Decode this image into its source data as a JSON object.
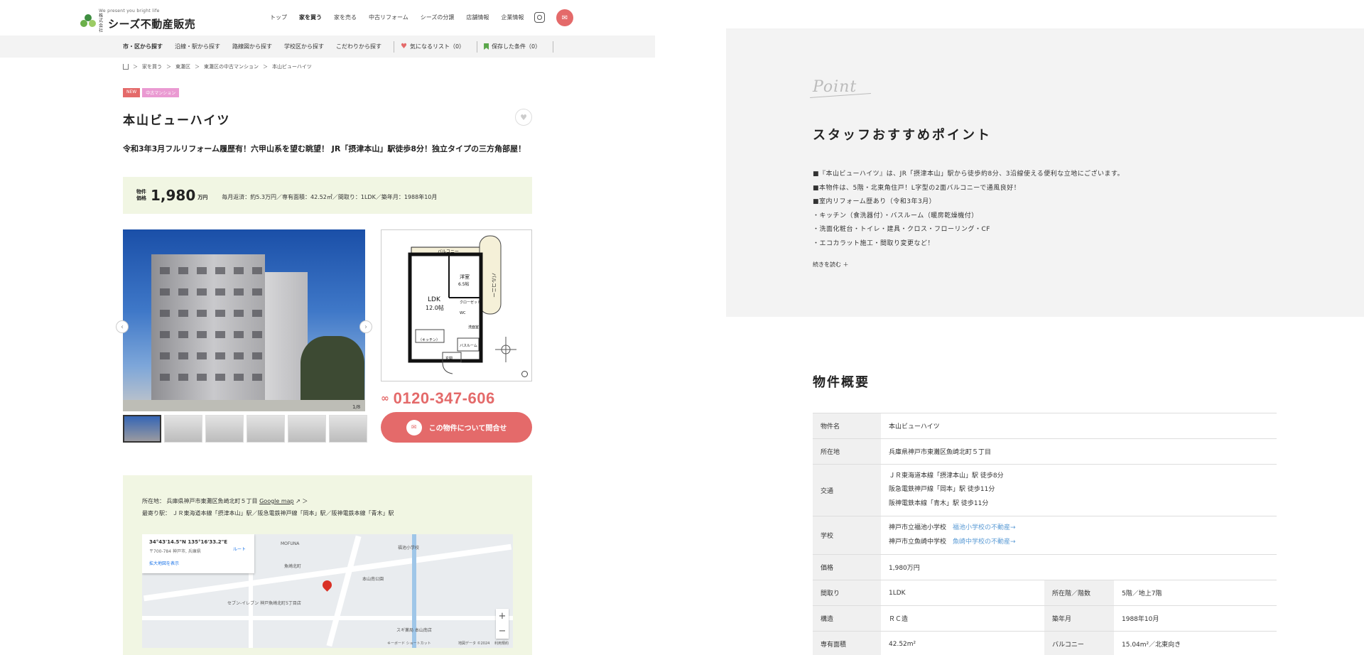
{
  "header": {
    "logo_tagline": "We present you bright life",
    "logo_corp": "株式会社",
    "logo_name": "シーズ不動産販売",
    "nav": [
      "トップ",
      "家を買う",
      "家を売る",
      "中古リフォーム",
      "シーズの分譲",
      "店舗情報",
      "企業情報"
    ]
  },
  "subnav": {
    "items": [
      "市・区から探す",
      "沿線・駅から探す",
      "路線図から探す",
      "学校区から探す",
      "こだわりから探す"
    ],
    "favorites": "気になるリスト（0）",
    "saved": "保存した条件（0）"
  },
  "breadcrumb": [
    "家を買う",
    "東灘区",
    "東灘区の中古マンション",
    "本山ビューハイツ"
  ],
  "badges": {
    "new": "NEW",
    "type": "中古マンション"
  },
  "property": {
    "title": "本山ビューハイツ",
    "catch": "令和3年3月フルリフォーム履歴有！六甲山系を望む眺望！ JR「摂津本山」駅徒歩8分！独立タイプの三方角部屋！",
    "price_label": "物件価格",
    "price": "1,980",
    "price_unit": "万円",
    "price_info": "毎月返済：約5.3万円／専有面積：42.52㎡／間取り：1LDK／築年月：1988年10月",
    "photo_counter": "1/8"
  },
  "floorplan": {
    "balcony_top": "バルコニー",
    "balcony_side": "バルコニー",
    "ldk": "LDK",
    "ldk_size": "12.0帖",
    "room": "洋室",
    "room_size": "6.5帖",
    "closet": "クローゼット",
    "wc": "WC",
    "wash": "洗面室",
    "kitchen": "（キッチン）",
    "bath": "バスルーム",
    "entrance": "玄関"
  },
  "contact": {
    "tel": "0120-347-606",
    "button": "この物件について問合せ"
  },
  "location": {
    "address_label": "所在地：",
    "address": "兵庫県神戸市東灘区魚崎北町５丁目",
    "map_link": "Google map",
    "station_label": "最寄り駅：",
    "station": "ＪＲ東海道本線「摂津本山」駅／阪急電鉄神戸線「岡本」駅／阪神電鉄本線「青木」駅",
    "map_coord": "34°43'14.5\"N 135°16'33.2\"E",
    "map_sub": "〒700-784 神戸市, 兵庫県",
    "map_route": "ルート",
    "map_enlarge": "拡大地図を表示",
    "map_labels": [
      "MOFUNA",
      "福池小学校",
      "魚崎北町",
      "本山南公園",
      "セブン-イレブン 神戸魚崎北町5丁目店",
      "スギ薬局 本山南店",
      "キーボード ショートカット",
      "地図データ ©2024",
      "利用規約"
    ]
  },
  "point": {
    "script": "Point",
    "title": "スタッフおすすめポイント",
    "lines": [
      "■『本山ビューハイツ』は、JR「摂津本山」駅から徒歩約8分、3沿線使える便利な立地にございます。",
      "■本物件は、5階・北東角住戸！L字型の2面バルコニーで通風良好！",
      "■室内リフォーム歴あり（令和3年3月）",
      "・キッチン（食洗器付）・バスルーム（暖房乾燥機付）",
      "・洗面化粧台・トイレ・建具・クロス・フローリング・CF",
      "・エコカラット施工・間取り変更など！"
    ],
    "readmore": "続きを読む ＋"
  },
  "spec": {
    "title": "物件概要",
    "name_label": "物件名",
    "name": "本山ビューハイツ",
    "address_label": "所在地",
    "address": "兵庫県神戸市東灘区魚崎北町５丁目",
    "traffic_label": "交通",
    "traffic": [
      "ＪＲ東海道本線「摂津本山」駅 徒歩8分",
      "阪急電鉄神戸線「岡本」駅 徒歩11分",
      "阪神電鉄本線「青木」駅 徒歩11分"
    ],
    "school_label": "学校",
    "school1": "神戸市立福池小学校",
    "school1_link": "福池小学校の不動産→",
    "school2": "神戸市立魚崎中学校",
    "school2_link": "魚崎中学校の不動産→",
    "price_label": "価格",
    "price": "1,980万円",
    "layout_label": "間取り",
    "layout": "1LDK",
    "floor_label": "所在階／階数",
    "floor": "5階／地上7階",
    "structure_label": "構造",
    "structure": "ＲＣ造",
    "built_label": "築年月",
    "built": "1988年10月",
    "area_label": "専有面積",
    "area": "42.52m²",
    "balcony_label": "バルコニー",
    "balcony": "15.04m²／北東向き"
  }
}
